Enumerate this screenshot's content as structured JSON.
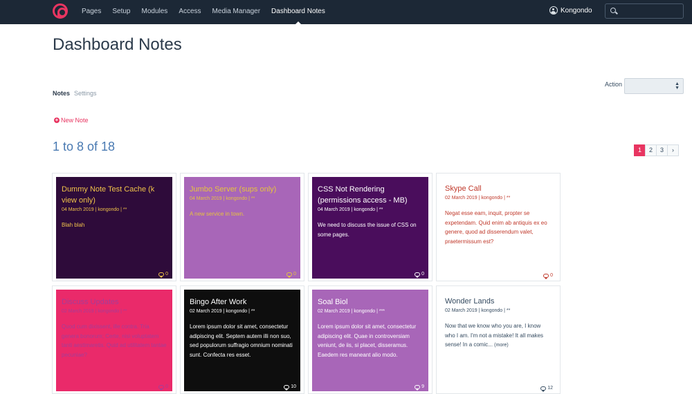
{
  "nav": {
    "items": [
      {
        "label": "Pages"
      },
      {
        "label": "Setup"
      },
      {
        "label": "Modules"
      },
      {
        "label": "Access"
      },
      {
        "label": "Media Manager"
      },
      {
        "label": "Dashboard Notes"
      }
    ],
    "active": "Dashboard Notes",
    "user": "Kongondo",
    "search_placeholder": ""
  },
  "header": {
    "title": "Dashboard Notes",
    "tabs": [
      {
        "label": "Notes"
      },
      {
        "label": "Settings"
      }
    ],
    "action_label": "Action",
    "new_note_label": "New Note"
  },
  "listing": {
    "count_text": "1 to 8 of 18",
    "pages": [
      "1",
      "2",
      "3",
      "›"
    ]
  },
  "notes": [
    {
      "title": "Dummy Note Test Cache (k view only)",
      "meta": "04 March 2019 | kongondo | **",
      "body": "Blah blah",
      "more": "",
      "comments": "0",
      "bg": "#2e0b3a",
      "fg": "#f0c34a",
      "plain": false
    },
    {
      "title": "Jumbo Server (sups only)",
      "meta": "04 March 2019 | kongondo | **",
      "body": "A new service in town.",
      "more": "",
      "comments": "0",
      "bg": "#a866b8",
      "fg": "#e6c43e",
      "plain": false
    },
    {
      "title": "CSS Not Rendering (permissions access - MB)",
      "meta": "04 March 2019 | kongondo | **",
      "body": "We need to discuss the issue of CSS on some pages.",
      "more": "",
      "comments": "0",
      "bg": "#4a0d5c",
      "fg": "#ffffff",
      "plain": false
    },
    {
      "title": "Skype Call",
      "meta": "02 March 2019 | kongondo | **",
      "body": "Negat esse eam, inquit, propter se expetendam. Quid enim ab antiquis ex eo genere, quod ad disserendum valet, praetermissum est?",
      "more": "",
      "comments": "0",
      "bg": "#ffffff",
      "fg": "#c0392b",
      "plain": true
    },
    {
      "title": "Discuss Updates",
      "meta": "02 March 2019 | kongondo | **",
      "body": "Quod cum dixissent, ille contra. Tria genera bonorum; Certe, nisi voluptatem tanti aestimaretis. Quid ad utilitatem tantae pecuniae?",
      "more": "",
      "comments": "0",
      "bg": "#ea2a6a",
      "fg": "#a43d98",
      "plain": false
    },
    {
      "title": "Bingo After Work",
      "meta": "02 March 2019 | kongondo | **",
      "body": "Lorem ipsum dolor sit amet, consectetur adipiscing elit. Septem autem illi non suo, sed populorum suffragio omnium nominati sunt. Confecta res esset.",
      "more": "",
      "comments": "10",
      "bg": "#0e0e0e",
      "fg": "#ffffff",
      "plain": false
    },
    {
      "title": "Soal Biol",
      "meta": "02 March 2019 | kongondo | ***",
      "body": "Lorem ipsum dolor sit amet, consectetur adipiscing elit. Quae in controversiam veniunt, de iis, si placet, disseramus. Eaedem res maneant alio modo.",
      "more": "",
      "comments": "9",
      "bg": "#a866b8",
      "fg": "#ffffff",
      "plain": false
    },
    {
      "title": "Wonder Lands",
      "meta": "02 March 2019 | kongondo | **",
      "body": "Now that we know who you are, I know who I am. I'm not a mistake! It all makes sense! In a comic...",
      "more": "(more)",
      "comments": "12",
      "bg": "#ffffff",
      "fg": "#354b60",
      "plain": true
    }
  ],
  "colors": {
    "brand": "#e83561",
    "topbar": "#1c2836",
    "link": "#4a7ab2"
  }
}
